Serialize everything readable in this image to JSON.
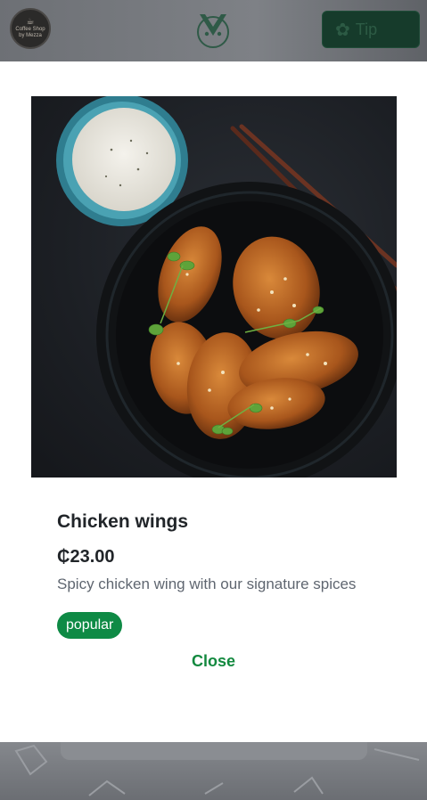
{
  "header": {
    "brand_badge_line1": "Coffee Shop",
    "brand_badge_line2": "by Mezza",
    "tip_button_label": "Tip",
    "tip_icon": "hands-icon"
  },
  "modal": {
    "item_name": "Chicken wings",
    "price": "₵23.00",
    "description": "Spicy chicken wing with our signature spices",
    "tag": "popular",
    "close_label": "Close"
  },
  "colors": {
    "accent_green": "#13893f",
    "tag_green": "#0e8a45",
    "text_dark": "#212529",
    "text_muted": "#5f6670"
  }
}
